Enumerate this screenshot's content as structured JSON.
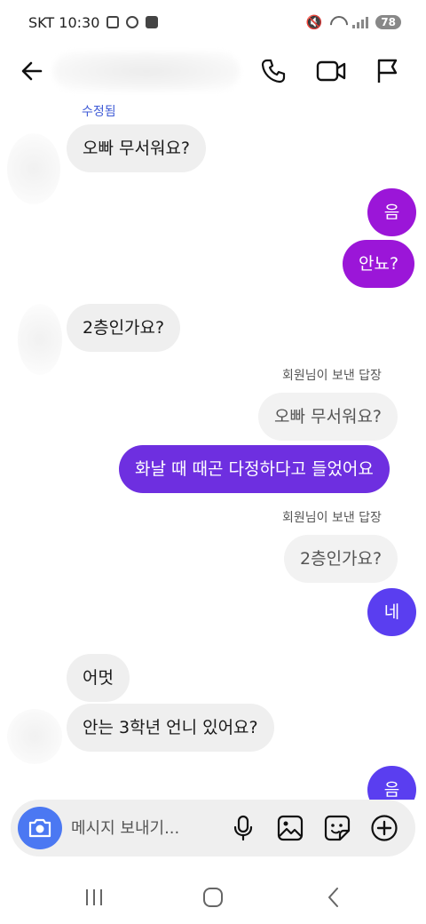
{
  "status_bar": {
    "carrier_time": "SKT 10:30",
    "battery": "78",
    "mute_icon": "mute-icon",
    "wifi_icon": "wifi-icon",
    "signal_icon": "signal-icon"
  },
  "header": {
    "back_icon": "back-arrow-icon",
    "call_icon": "phone-icon",
    "video_icon": "video-camera-icon",
    "report_icon": "flag-icon"
  },
  "messages": {
    "edited_label": "수정됨",
    "m1": "오빠 무서워요?",
    "m2": "음",
    "m3": "안뇨?",
    "m4": "2층인가요?",
    "reply1_label": "회원님이 보낸 답장",
    "reply1_quote": "오빠 무서워요?",
    "m5": "화날 때 때곤 다정하다고 들었어요",
    "reply2_label": "회원님이 보낸 답장",
    "reply2_quote": "2층인가요?",
    "m6": "네",
    "m7": "어멋",
    "m8": "안는 3학년 언니 있어요?",
    "m9": "음"
  },
  "composer": {
    "placeholder": "메시지 보내기...",
    "camera_icon": "camera-icon",
    "mic_icon": "microphone-icon",
    "gallery_icon": "image-icon",
    "sticker_icon": "sticker-icon",
    "plus_icon": "plus-circle-icon"
  },
  "colors": {
    "accent_blue": "#4b78f2",
    "sent_purple": "#9b16d8",
    "sent_violet": "#6e2fe0",
    "sent_indigo": "#5a3ef0",
    "received_bg": "#efefef"
  }
}
